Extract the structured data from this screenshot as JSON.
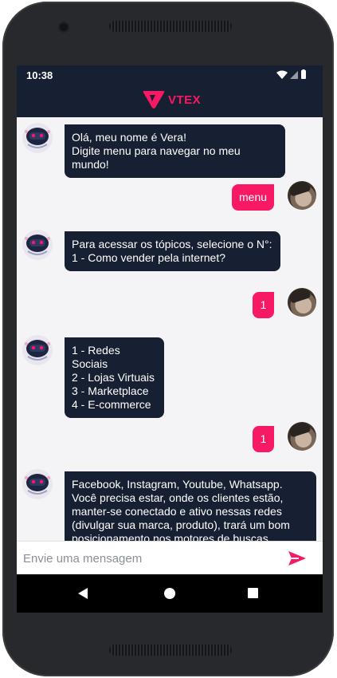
{
  "status_bar": {
    "time": "10:38",
    "icons": [
      "wifi-icon",
      "signal-icon",
      "battery-icon"
    ]
  },
  "header": {
    "brand": "VTEX",
    "brand_color": "#f71963",
    "background": "#172032"
  },
  "messages": [
    {
      "from": "bot",
      "text": "Olá, meu nome é Vera!\nDigite menu para navegar no meu mundo!"
    },
    {
      "from": "user",
      "text": "menu"
    },
    {
      "from": "bot",
      "text": "Para acessar os tópicos, selecione o N°:\n1 - Como vender pela internet?"
    },
    {
      "from": "user",
      "text": "1"
    },
    {
      "from": "bot",
      "text": "1 - Redes Sociais\n2 - Lojas Virtuais\n3 - Marketplace\n4 - E-commerce"
    },
    {
      "from": "user",
      "text": "1"
    },
    {
      "from": "bot",
      "text": "Facebook, Instagram, Youtube, Whatsapp.\nVocê precisa estar, onde os clientes estão, manter-se conectado e ativo nessas redes (divulgar sua marca, produto), trará um bom posicionamento nos motores de buscas."
    }
  ],
  "composer": {
    "placeholder": "Envie uma mensagem",
    "send_icon": "send-icon"
  },
  "nav": {
    "icons": [
      "back-icon",
      "home-icon",
      "recents-icon"
    ]
  },
  "colors": {
    "user_bubble": "#f71963",
    "bot_bubble": "#172032",
    "chat_background": "#f4f4f6"
  }
}
